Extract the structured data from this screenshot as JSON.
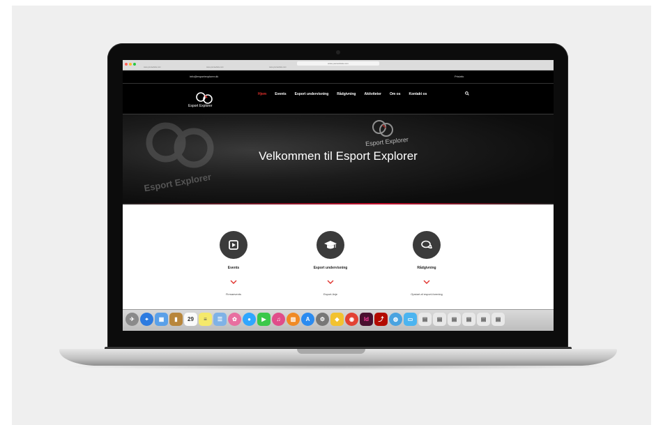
{
  "browser": {
    "url": "www.yourwebsite.com",
    "tabs": [
      "www.yourwebsite.com",
      "www.yourwebsite.com",
      "www.yourwebsite.com"
    ]
  },
  "topbar": {
    "email": "info@esportexplorer.dk",
    "price_link": "Prisinfo"
  },
  "logo": {
    "text": "Esport Explorer"
  },
  "nav": {
    "items": [
      "Hjem",
      "Events",
      "Esport undervisning",
      "Rådgivning",
      "Aktiviteter",
      "Om os",
      "Kontakt os"
    ],
    "active": "Hjem"
  },
  "hero": {
    "title": "Velkommen til Esport Explorer",
    "watermark": "Esport Explorer",
    "watermark2": "Esport Explorer"
  },
  "features": [
    {
      "title": "Events",
      "subtitle": "Firmaevents",
      "icon": "play-icon"
    },
    {
      "title": "Esport undervisning",
      "subtitle": "Esport-linje",
      "icon": "graduation-cap-icon"
    },
    {
      "title": "Rådgivning",
      "subtitle": "Opstart af esport-forening",
      "icon": "chat-bubbles-icon"
    }
  ],
  "dock": {
    "calendar_day": "29",
    "indesign_label": "Id"
  },
  "colors": {
    "accent": "#e0302b",
    "dark": "#000000",
    "icon_circle": "#3b3b3b"
  }
}
